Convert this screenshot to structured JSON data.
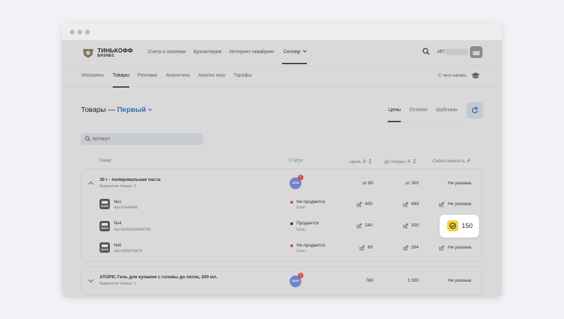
{
  "topnav": {
    "brand": "ТИНЬКОФФ",
    "brand_sub": "БИЗНЕС",
    "links": [
      "Счета и платежи",
      "Бухгалтерия",
      "Интернет-эквайринг",
      "Селлер"
    ],
    "account_label": "ИП"
  },
  "subnav": {
    "links": [
      "Магазины",
      "Товары",
      "Реклама",
      "Аналитика",
      "Анализ ниш",
      "Тарифы"
    ],
    "start_label": "С чего начать"
  },
  "heading": {
    "title": "Товары —",
    "store": "Первый"
  },
  "view_tabs": [
    "Цены",
    "Остатки",
    "Шаблоны"
  ],
  "search": {
    "placeholder": "Артикул"
  },
  "columns": {
    "product": "Товар",
    "status": "Статус",
    "price": "Цена, ₽",
    "before_discount": "До скидки, ₽",
    "cost": "Себестоимость, ₽"
  },
  "groups": [
    {
      "title": "35 г - полировальная паста",
      "variants": "Вариантов товара: 2",
      "price": "от 80",
      "before_discount": "от 300",
      "cost": "Не указана",
      "badge_text": "OZON",
      "alert": "!",
      "items": [
        {
          "name": "№1",
          "sku": "Арт.65444645",
          "status": "Не продается",
          "marketplace": "Ozon",
          "status_color": "#c94a4a",
          "price": "400",
          "before_discount": "669",
          "cost": "Не указана"
        },
        {
          "name": "№4",
          "sku": "Арт.56456656468768",
          "status": "Продается",
          "marketplace": "Ozon",
          "status_color": "#333333",
          "price": "240",
          "before_discount": "300",
          "cost": "150"
        },
        {
          "name": "№6",
          "sku": "Арт.6456878878",
          "status": "Не продается",
          "marketplace": "Ozon",
          "status_color": "#c94a4a",
          "price": "80",
          "before_discount": "304",
          "cost": "Не указана"
        }
      ]
    },
    {
      "title": "ATOPIC Гель для купания с головы до пяток, 200 мл.",
      "variants": "Вариантов товара: 1",
      "price": "760",
      "before_discount": "1 000",
      "cost": "Не указана",
      "badge_text": "OZON",
      "alert": "!"
    }
  ],
  "colors": {
    "accent": "#3a6fb0",
    "highlight": "#f3d33b",
    "alert": "#d24b4b"
  }
}
